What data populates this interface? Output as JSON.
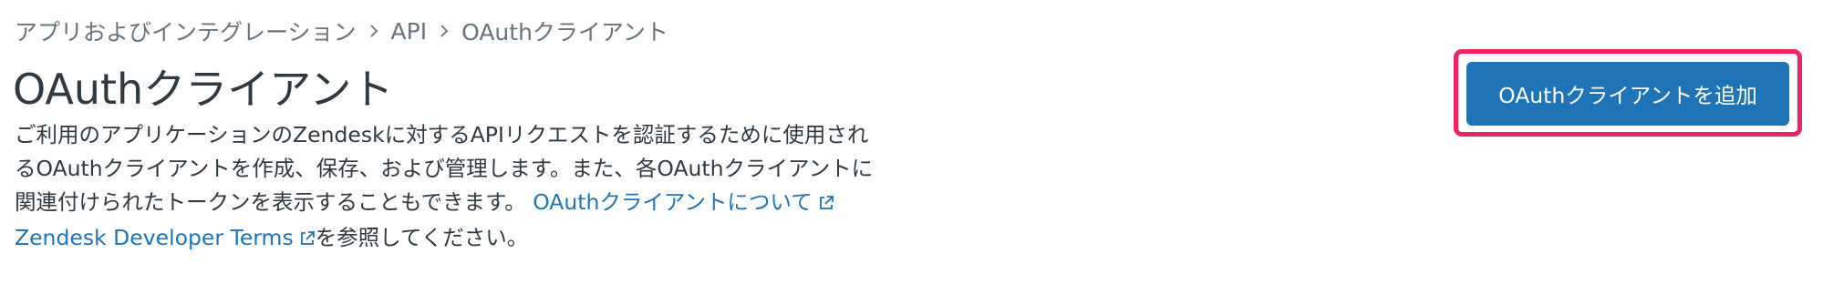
{
  "breadcrumb": {
    "items": [
      "アプリおよびインテグレーション",
      "API",
      "OAuthクライアント"
    ]
  },
  "page_title": "OAuthクライアント",
  "description": {
    "line1": "ご利用のアプリケーションのZendeskに対するAPIリクエストを認証するために使用され",
    "line2": "るOAuthクライアントを作成、保存、および管理します。また、各OAuthクライアントに",
    "line3_text": "関連付けられたトークンを表示することもできます。",
    "oauth_link": "OAuthクライアントについて",
    "terms_link": "Zendesk Developer Terms",
    "terms_suffix": "を参照してください。"
  },
  "add_button_label": "OAuthクライアントを追加",
  "colors": {
    "link": "#1f73b7",
    "button_bg": "#1f73b7",
    "highlight_border": "#f0245e",
    "muted_text": "#68737d"
  },
  "icons": [
    "chevron-right-icon",
    "external-link-icon"
  ]
}
